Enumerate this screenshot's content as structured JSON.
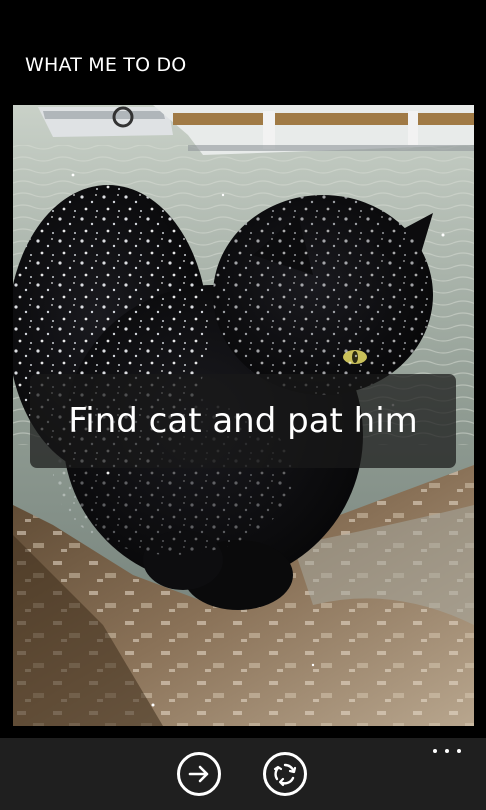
{
  "header": {
    "title": "WHAT ME TO DO"
  },
  "photo": {
    "caption": "Find cat and pat him"
  },
  "app_bar": {
    "buttons": [
      {
        "icon": "arrow-right-icon"
      },
      {
        "icon": "refresh-icon"
      }
    ],
    "more_icon": "more-dots-icon"
  },
  "colors": {
    "background": "#000000",
    "app_bar": "#1f1f1f",
    "text": "#ffffff"
  }
}
